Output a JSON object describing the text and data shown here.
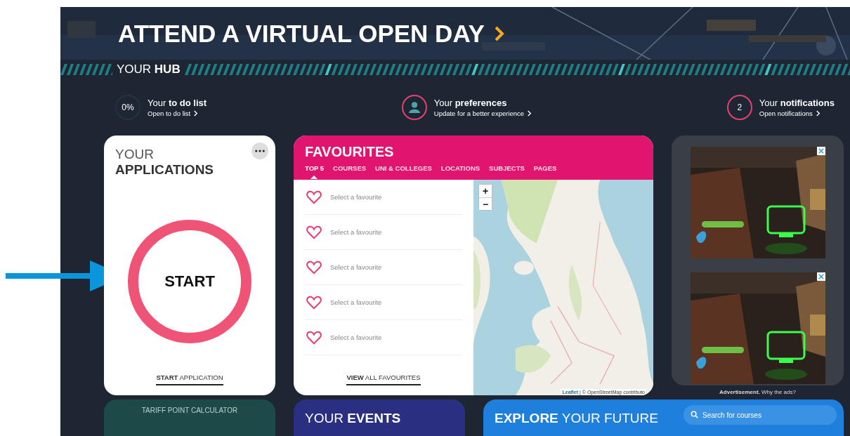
{
  "banner": {
    "title": "ATTEND A VIRTUAL OPEN DAY"
  },
  "hub": {
    "heading": "YOUR **HUB**"
  },
  "hub_items": [
    {
      "kind": "progress",
      "badge": "0%",
      "heading": "Your **to do list**",
      "link": "Open to do list"
    },
    {
      "kind": "avatar",
      "heading": "Your **preferences**",
      "link": "Update for a better experience"
    },
    {
      "kind": "count",
      "badge": "2",
      "heading": "Your **notifications**",
      "link": "Open notifications"
    }
  ],
  "applications": {
    "line_1": "YOUR",
    "line_2": "APPLICATIONS",
    "action": "START",
    "link": "**START** APPLICATION"
  },
  "favourites": {
    "title": "FAVOURITES",
    "tabs": [
      {
        "label": "TOP 5",
        "selected": true
      },
      {
        "label": "COURSES",
        "selected": false
      },
      {
        "label": "UNI & COLLEGES",
        "selected": false
      },
      {
        "label": "LOCATIONS",
        "selected": false
      },
      {
        "label": "SUBJECTS",
        "selected": false
      },
      {
        "label": "PAGES",
        "selected": false
      }
    ],
    "items": [
      "Select a favourite",
      "Select a favourite",
      "Select a favourite",
      "Select a favourite",
      "Select a favourite"
    ],
    "link": "**VIEW** ALL FAVOURITES",
    "map": {
      "kind": "picture",
      "zoom_in": "+",
      "zoom_out": "−",
      "attribution_link": "Leaflet",
      "attribution": "| © OpenStreetMap contributo"
    }
  },
  "ads": {
    "caption": "**Advertisement.** Why the ads?"
  },
  "bottom_cards": [
    {
      "kind": "tariff",
      "title": "TARIFF POINT CALCULATOR"
    },
    {
      "kind": "events",
      "title": "YOUR **EVENTS**"
    },
    {
      "kind": "explore",
      "title": "**EXPLORE** YOUR FUTURE",
      "search_placeholder": "Search for courses"
    }
  ]
}
